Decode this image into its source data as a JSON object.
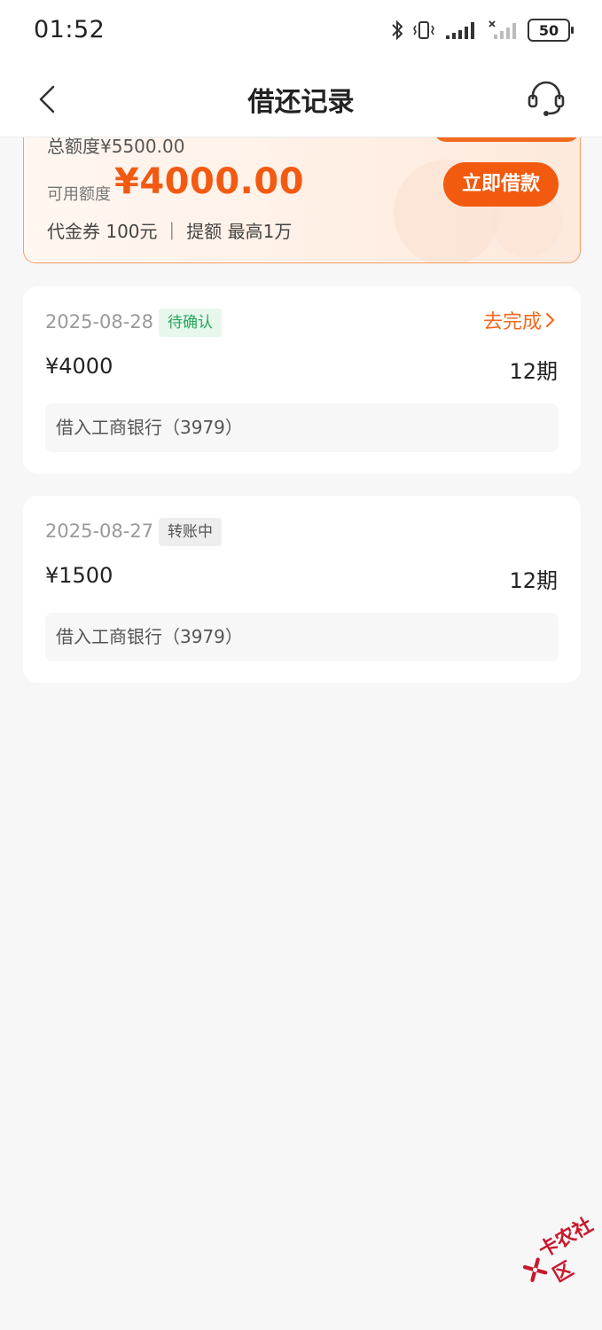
{
  "status_bar": {
    "time": "01:52",
    "battery": "50",
    "icons": [
      "bluetooth-icon",
      "vibrate-icon",
      "signal-icon",
      "signal-off-icon",
      "battery-icon"
    ]
  },
  "nav": {
    "title": "借还记录",
    "back_icon": "chevron-left-icon",
    "service_icon": "headset-icon"
  },
  "credit_card": {
    "total_limit": "总额度¥5500.00",
    "available_label": "可用额度",
    "available_amount": "¥4000.00",
    "perks": "代金券 100元 ｜ 提额 最高1万",
    "borrow_button": "立即借款"
  },
  "records": [
    {
      "date": "2025-08-28",
      "status": "待确认",
      "action": "去完成",
      "amount": "¥4000",
      "term": "12期",
      "bank": "借入工商银行（3979）"
    },
    {
      "date": "2025-08-27",
      "status": "转账中",
      "amount": "¥1500",
      "term": "12期",
      "bank": "借入工商银行（3979）"
    }
  ],
  "watermark": "卡农社区",
  "colors": {
    "accent": "#f25a0f",
    "status_green": "#26a65b",
    "watermark_red": "#c9182c"
  }
}
